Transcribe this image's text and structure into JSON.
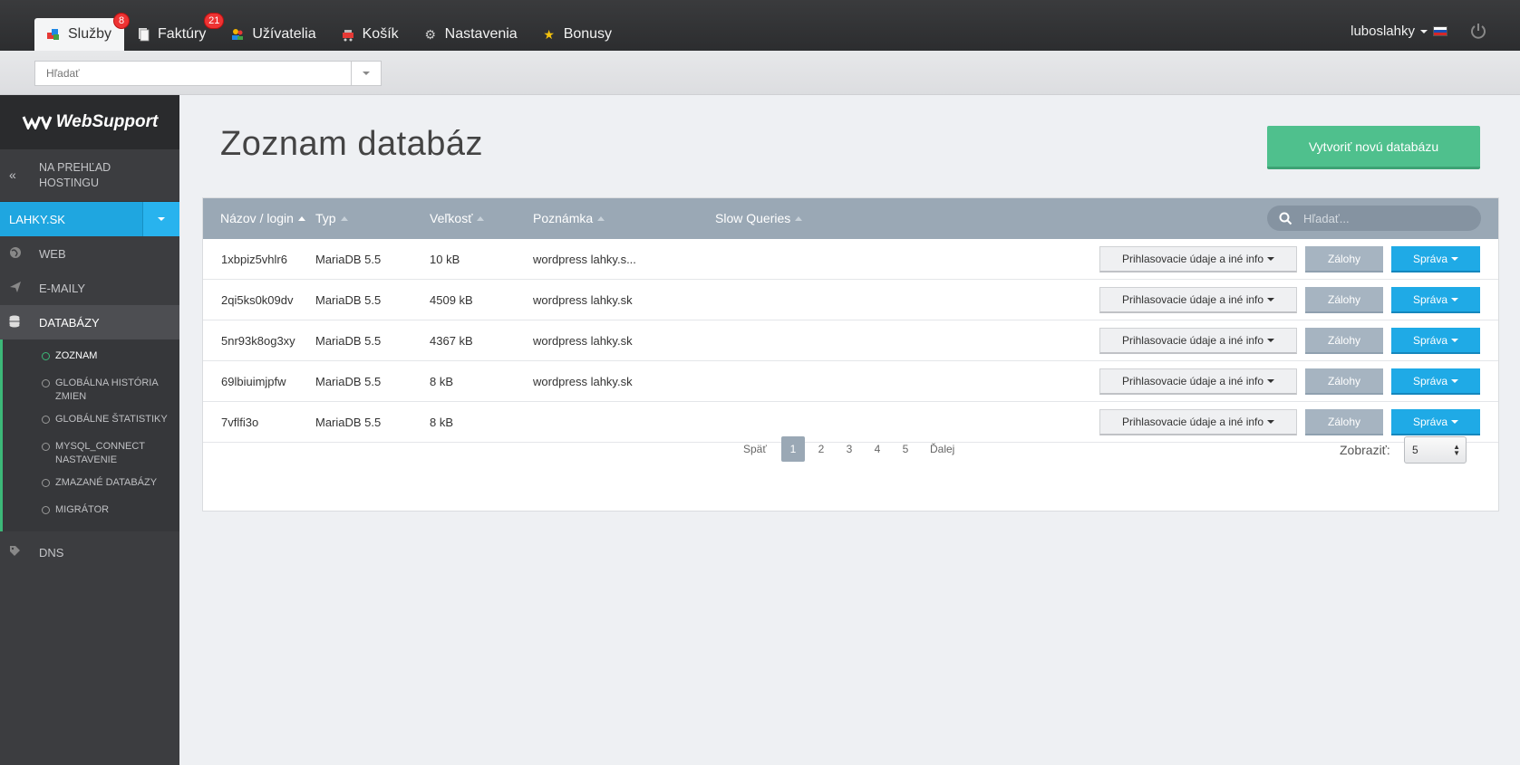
{
  "topnav": {
    "items": [
      {
        "label": "Služby",
        "icon": "services-icon",
        "badge": "8",
        "active": true
      },
      {
        "label": "Faktúry",
        "icon": "invoices-icon",
        "badge": "21"
      },
      {
        "label": "Užívatelia",
        "icon": "users-icon"
      },
      {
        "label": "Košík",
        "icon": "cart-icon"
      },
      {
        "label": "Nastavenia",
        "icon": "gear-icon"
      },
      {
        "label": "Bonusy",
        "icon": "star-icon"
      }
    ],
    "user": "luboslahky"
  },
  "searchbar": {
    "placeholder": "Hľadať"
  },
  "sidebar": {
    "logo": "WebSupport",
    "back_label": "NA PREHĽAD HOSTINGU",
    "domain": "LAHKY.SK",
    "items": [
      {
        "label": "WEB",
        "icon": "globe-icon"
      },
      {
        "label": "E-MAILY",
        "icon": "send-icon"
      },
      {
        "label": "DATABÁZY",
        "icon": "database-icon",
        "active": true
      }
    ],
    "subitems": [
      {
        "label": "ZOZNAM",
        "active": true
      },
      {
        "label": "GLOBÁLNA HISTÓRIA ZMIEN"
      },
      {
        "label": "GLOBÁLNE ŠTATISTIKY"
      },
      {
        "label": "MYSQL_CONNECT NASTAVENIE"
      },
      {
        "label": "ZMAZANÉ DATABÁZY"
      },
      {
        "label": "MIGRÁTOR"
      }
    ],
    "dns": {
      "label": "DNS",
      "icon": "tag-icon"
    }
  },
  "main": {
    "title": "Zoznam databáz",
    "create_button": "Vytvoriť novú databázu"
  },
  "table": {
    "columns": [
      "Názov / login",
      "Typ",
      "Veľkosť",
      "Poznámka",
      "Slow Queries"
    ],
    "search_placeholder": "Hľadať...",
    "rows": [
      {
        "name": "1xbpiz5vhlr6",
        "type": "MariaDB 5.5",
        "size": "10 kB",
        "note": "wordpress lahky.s..."
      },
      {
        "name": "2qi5ks0k09dv",
        "type": "MariaDB 5.5",
        "size": "4509 kB",
        "note": "wordpress lahky.sk"
      },
      {
        "name": "5nr93k8og3xy",
        "type": "MariaDB 5.5",
        "size": "4367 kB",
        "note": "wordpress lahky.sk"
      },
      {
        "name": "69lbiuimjpfw",
        "type": "MariaDB 5.5",
        "size": "8 kB",
        "note": "wordpress lahky.sk"
      },
      {
        "name": "7vflfi3o",
        "type": "MariaDB 5.5",
        "size": "8 kB",
        "note": ""
      }
    ],
    "actions": {
      "info": "Prihlasovacie údaje a iné info",
      "backup": "Zálohy",
      "manage": "Správa"
    }
  },
  "pagination": {
    "prev": "Späť",
    "pages": [
      "1",
      "2",
      "3",
      "4",
      "5"
    ],
    "current": "1",
    "next": "Ďalej",
    "show_label": "Zobraziť:",
    "show_value": "5"
  }
}
